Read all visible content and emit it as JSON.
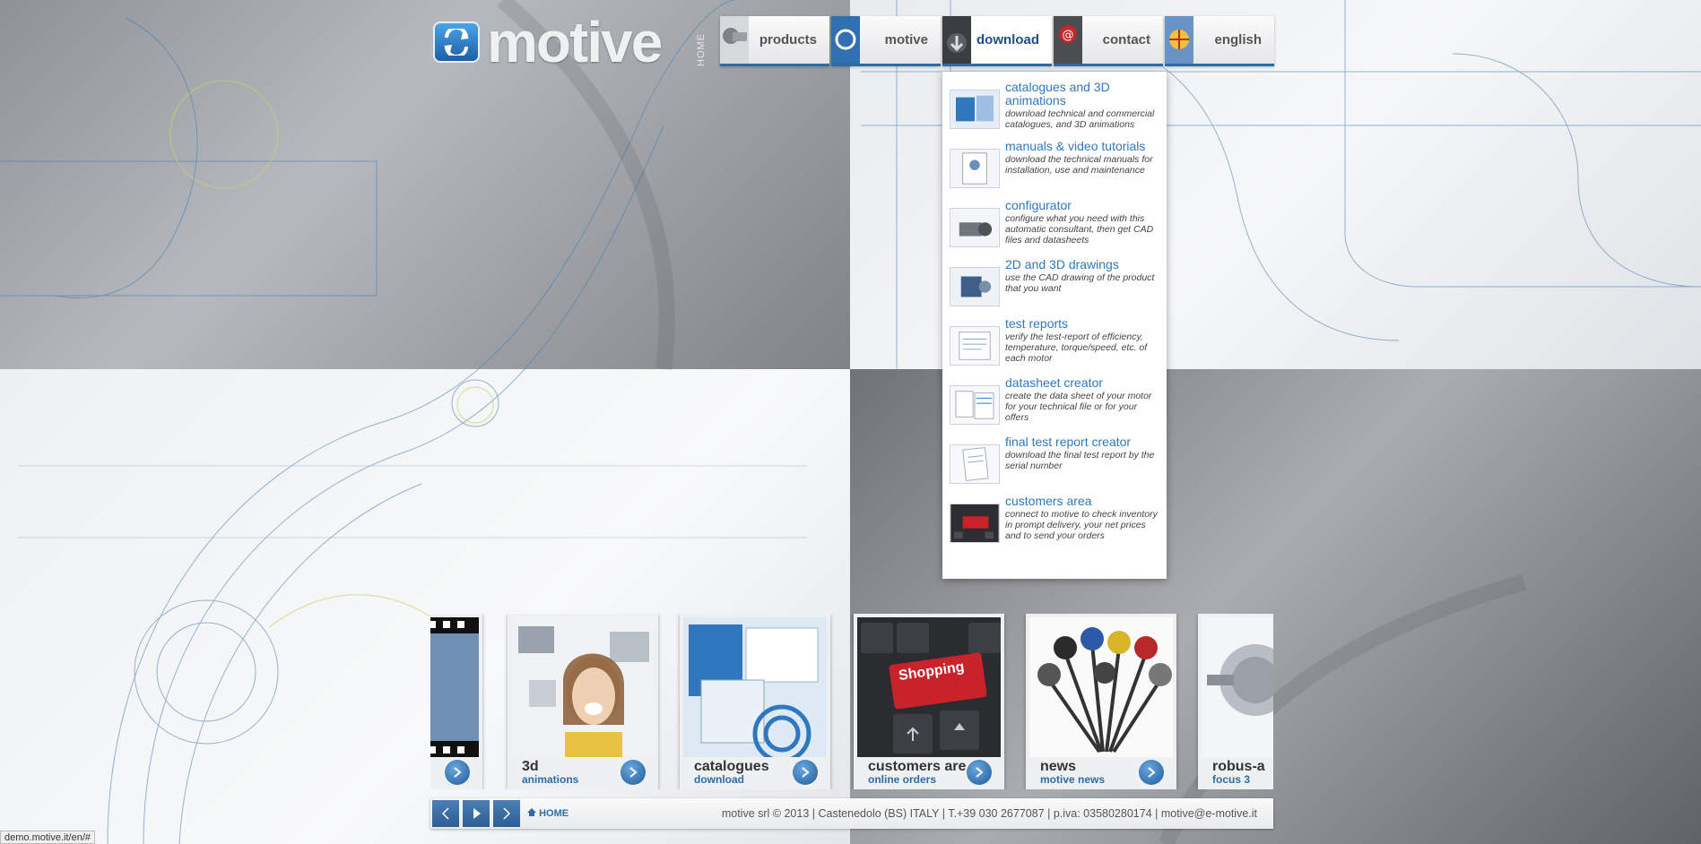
{
  "header": {
    "logo_text": "motive",
    "home_vertical": "HOME",
    "nav": [
      {
        "label": "products"
      },
      {
        "label": "motive"
      },
      {
        "label": "download"
      },
      {
        "label": "contact"
      },
      {
        "label": "english"
      }
    ]
  },
  "dropdown": {
    "items": [
      {
        "title": "catalogues and 3D animations",
        "desc": "download technical and commercial catalogues, and 3D animations"
      },
      {
        "title": "manuals & video tutorials",
        "desc": "download the technical manuals for installation, use and maintenance"
      },
      {
        "title": "configurator",
        "desc": "configure what you need with this automatic consultant, then get CAD files and datasheets"
      },
      {
        "title": "2D and 3D drawings",
        "desc": "use the CAD drawing of the product that you want"
      },
      {
        "title": "test reports",
        "desc": "verify the test-report of efficiency, temperature, torque/speed, etc. of each motor"
      },
      {
        "title": "datasheet creator",
        "desc": "create the data sheet of your motor for your technical file or for your offers"
      },
      {
        "title": "final test report creator",
        "desc": "download the final test report by the serial number"
      },
      {
        "title": "customers area",
        "desc": "connect to motive to check inventory in prompt delivery, your net prices and to send your orders"
      }
    ]
  },
  "carousel": {
    "cards": [
      {
        "title": "3d",
        "sub": "animations"
      },
      {
        "title": "catalogues",
        "sub": "download"
      },
      {
        "title": "customers are",
        "sub": "online orders"
      },
      {
        "title": "news",
        "sub": "motive news"
      },
      {
        "title": "robus-a",
        "sub": "focus 3"
      }
    ],
    "shopping_key": "Shopping"
  },
  "footer": {
    "home_label": "HOME",
    "info": "motive srl © 2013 | Castenedolo (BS) ITALY | T.+39 030 2677087 | p.iva: 03580280174 | motive@e-motive.it"
  },
  "status_url": "demo.motive.it/en/#",
  "colors": {
    "accent": "#2e6da4",
    "link": "#2f78c0"
  }
}
